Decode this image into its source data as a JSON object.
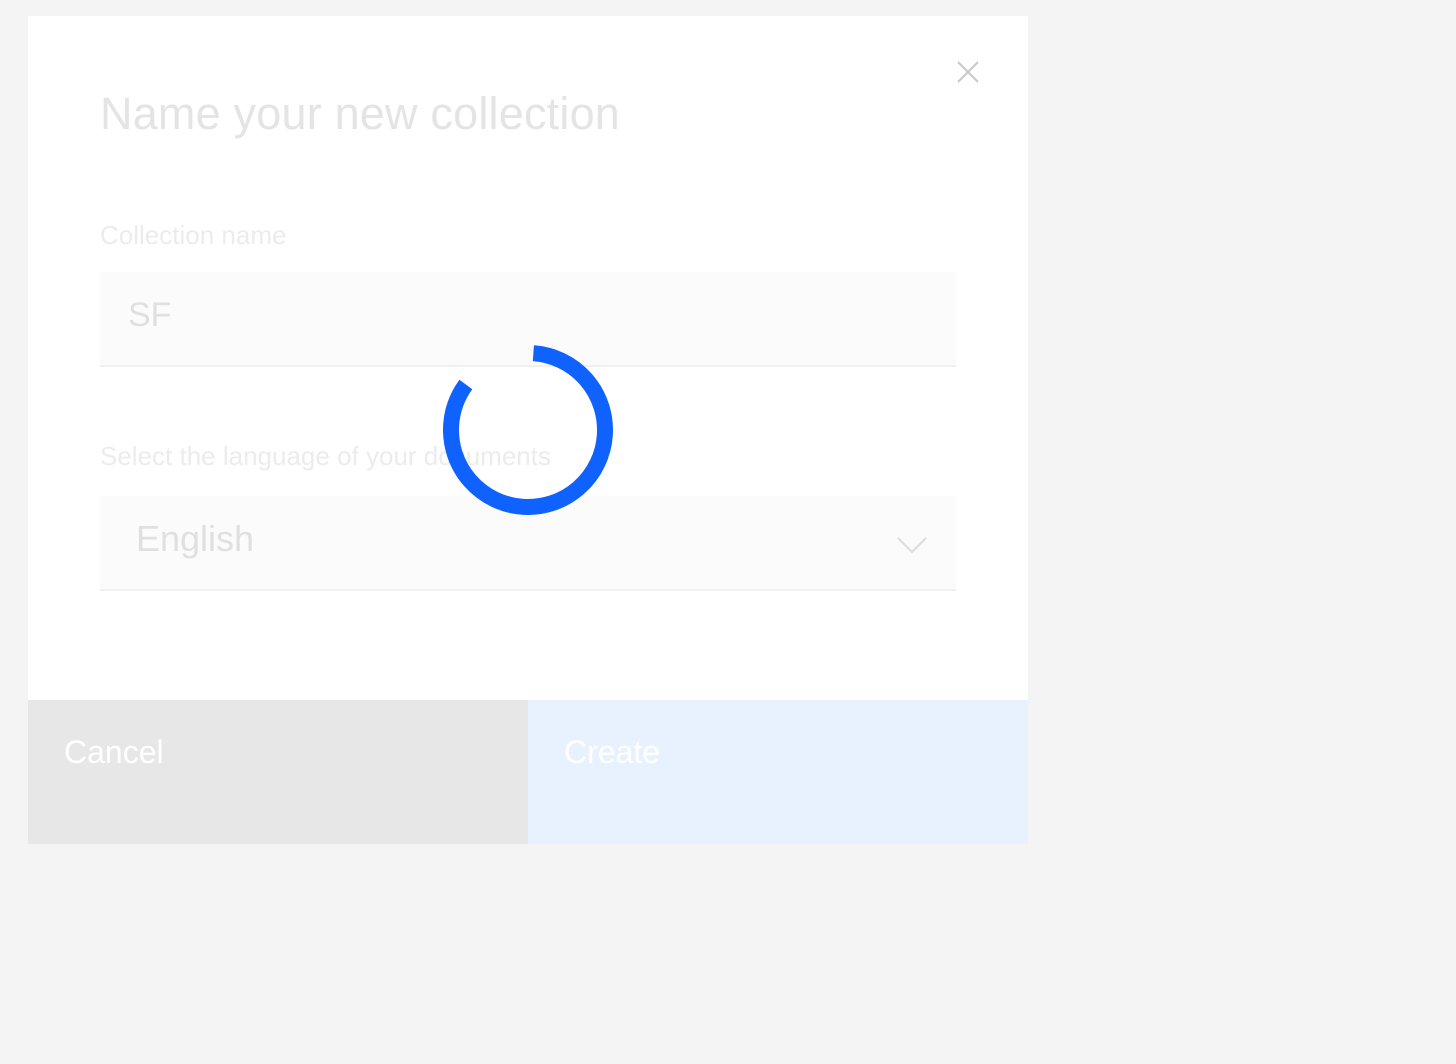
{
  "modal": {
    "title": "Name your new collection",
    "close_icon": "close-icon",
    "collection_name": {
      "label": "Collection name",
      "value": "SF"
    },
    "language": {
      "label": "Select the language of your documents",
      "selected": "English",
      "chevron_icon": "chevron-down-icon"
    },
    "footer": {
      "cancel_label": "Cancel",
      "create_label": "Create"
    }
  },
  "loading": {
    "icon": "loading-spinner-icon",
    "accent_color": "#0f62fe"
  },
  "colors": {
    "page_background": "#f4f4f4",
    "modal_background": "#ffffff",
    "cancel_button": "#e7e7e7",
    "create_button": "#e8f2ff"
  }
}
